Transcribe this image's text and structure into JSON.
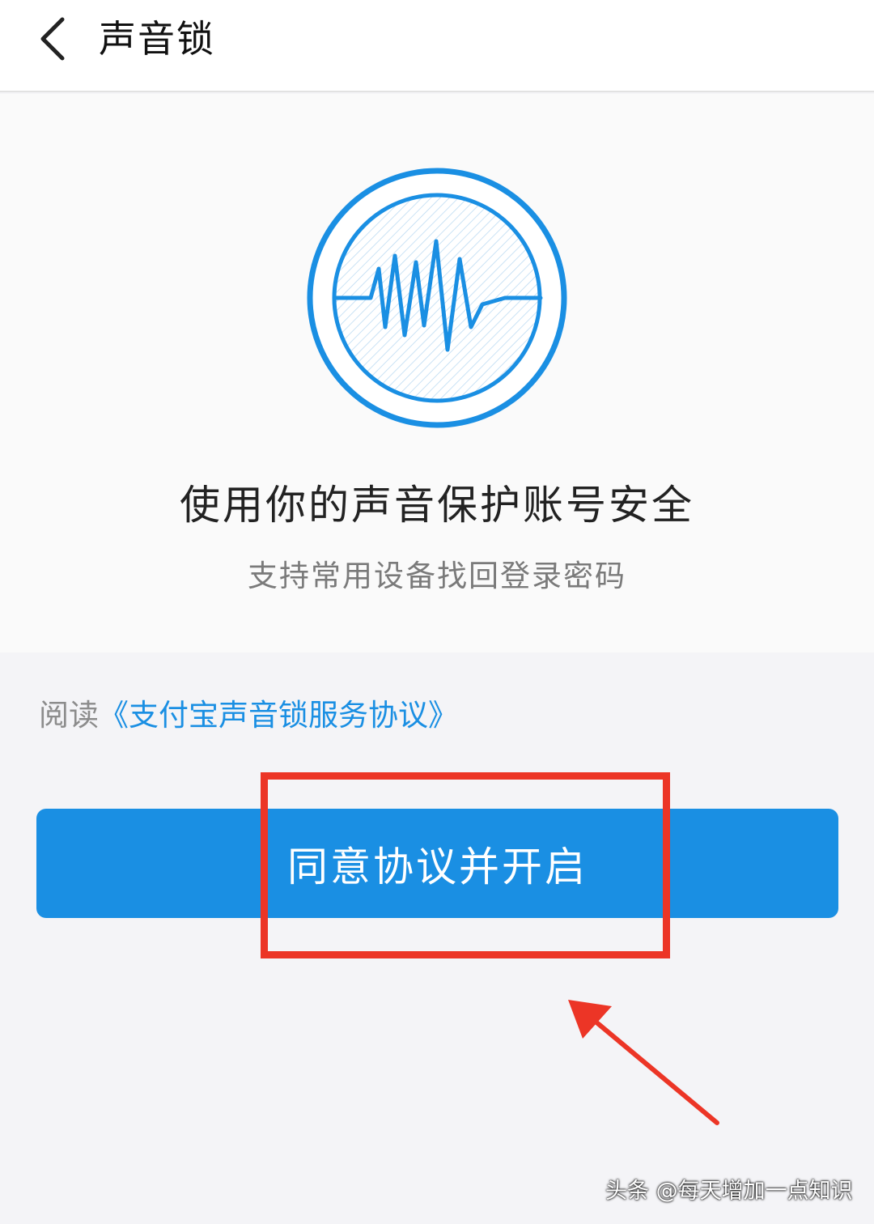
{
  "header": {
    "back_icon": "chevron-left-icon",
    "title": "声音锁"
  },
  "hero": {
    "icon": "sound-wave-icon",
    "accent_color": "#1a8fe3",
    "title": "使用你的声音保护账号安全",
    "subtitle": "支持常用设备找回登录密码"
  },
  "agreement": {
    "prefix": "阅读",
    "link_text": "《支付宝声音锁服务协议》",
    "link_color": "#1a8fe3"
  },
  "primary_button": {
    "label": "同意协议并开启",
    "color": "#1a8fe3"
  },
  "annotation": {
    "highlight_color": "#ec3526"
  },
  "watermark": {
    "text": "头条 @每天增加一点知识"
  }
}
